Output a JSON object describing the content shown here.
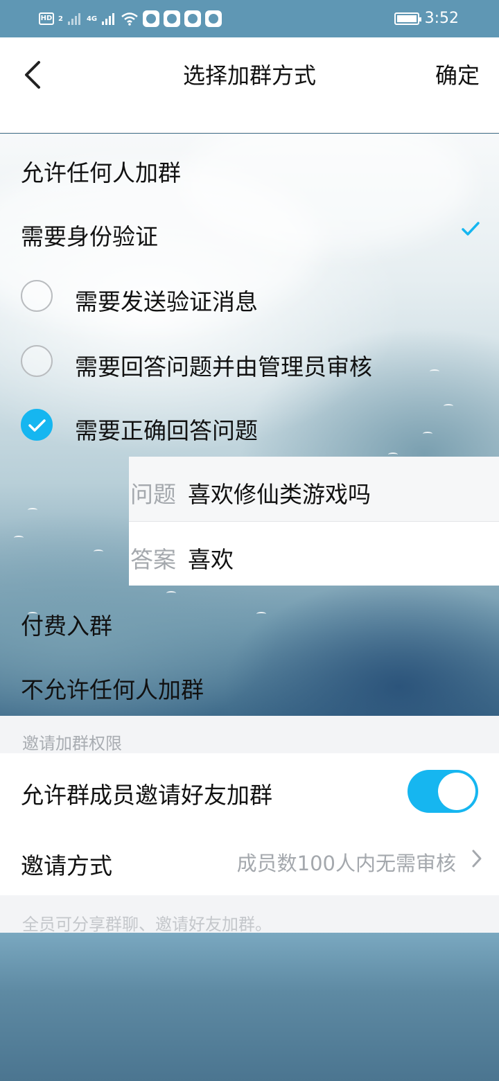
{
  "status_bar": {
    "left_tags": [
      "HD",
      "2",
      "4G"
    ],
    "time": "3:52",
    "icons": [
      "signal-icon",
      "signal-4g-icon",
      "wifi-icon",
      "app-icon",
      "app-icon",
      "app-icon",
      "app-icon",
      "battery-icon"
    ]
  },
  "header": {
    "title": "选择加群方式",
    "confirm_label": "确定"
  },
  "join_options": {
    "anyone": "允许任何人加群",
    "verify": "需要身份验证",
    "sub_options": [
      {
        "label": "需要发送验证消息",
        "checked": false
      },
      {
        "label": "需要回答问题并由管理员审核",
        "checked": false
      },
      {
        "label": "需要正确回答问题",
        "checked": true
      }
    ],
    "qa": {
      "question_label": "问题",
      "question_value": "喜欢修仙类游戏吗",
      "answer_label": "答案",
      "answer_value": "喜欢"
    },
    "paid": "付费入群",
    "nobody": "不允许任何人加群"
  },
  "invite": {
    "section_label": "邀请加群权限",
    "allow_member_invite_label": "允许群成员邀请好友加群",
    "allow_member_invite_on": true,
    "method_label": "邀请方式",
    "method_value": "成员数100人内无需审核",
    "footer_note": "全员可分享群聊、邀请好友加群。"
  },
  "colors": {
    "accent": "#16b6f0",
    "status_bar": "#5f97b4",
    "muted_text": "#a4a8ad"
  }
}
